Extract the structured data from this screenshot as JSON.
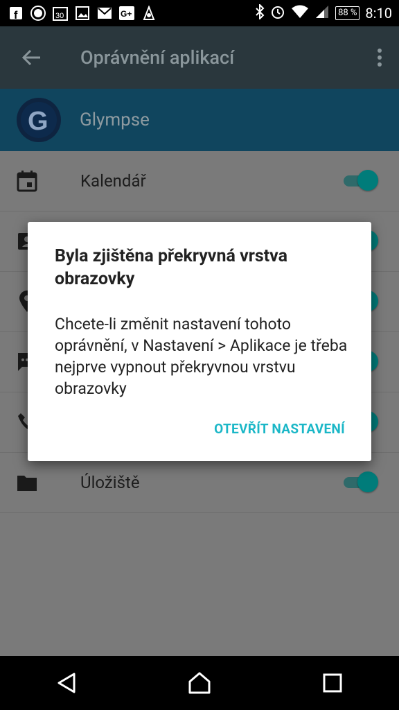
{
  "status_bar": {
    "battery": "88 %",
    "time": "8:10",
    "icons": [
      "facebook-icon",
      "mi-icon",
      "calendar-30-icon",
      "image-icon",
      "gmail-icon",
      "gplus-icon",
      "notification-icon",
      "bluetooth-icon",
      "alarm-icon",
      "wifi-icon",
      "signal-icon"
    ]
  },
  "app_bar": {
    "title": "Oprávnění aplikací"
  },
  "app_header": {
    "name": "Glympse"
  },
  "permissions": [
    {
      "label": "Kalendář",
      "icon": "calendar-icon",
      "enabled": true
    },
    {
      "label": "",
      "icon": "contacts-icon",
      "enabled": true
    },
    {
      "label": "",
      "icon": "location-icon",
      "enabled": true
    },
    {
      "label": "",
      "icon": "sms-icon",
      "enabled": true
    },
    {
      "label": "",
      "icon": "phone-icon",
      "enabled": true
    },
    {
      "label": "Úložiště",
      "icon": "folder-icon",
      "enabled": true
    }
  ],
  "dialog": {
    "title": "Byla zjištěna překryvná vrstva obrazovky",
    "body": "Chcete-li změnit nastavení tohoto oprávnění, v Nastavení > Aplikace je třeba nejprve vypnout překryvnou vrstvu obrazovky",
    "action": "OTEVŘÍT NASTAVENÍ"
  },
  "colors": {
    "accent": "#1bb7c7",
    "toggle_on": "#007c7a",
    "app_bar": "#2a373d",
    "app_header": "#10455e"
  }
}
